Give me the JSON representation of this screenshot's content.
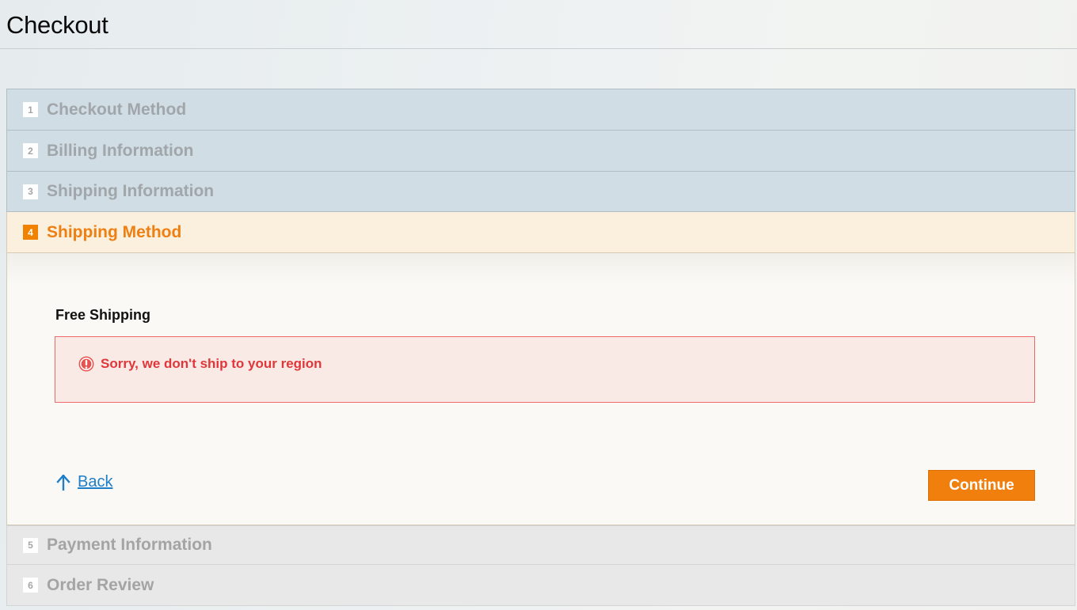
{
  "page": {
    "title": "Checkout"
  },
  "steps": [
    {
      "number": "1",
      "label": "Checkout Method",
      "state": "complete"
    },
    {
      "number": "2",
      "label": "Billing Information",
      "state": "complete"
    },
    {
      "number": "3",
      "label": "Shipping Information",
      "state": "complete"
    },
    {
      "number": "4",
      "label": "Shipping Method",
      "state": "active"
    },
    {
      "number": "5",
      "label": "Payment Information",
      "state": "pending"
    },
    {
      "number": "6",
      "label": "Order Review",
      "state": "pending"
    }
  ],
  "shipping_method": {
    "method_title": "Free Shipping",
    "error_message": "Sorry, we don't ship to your region",
    "back_label": "Back",
    "continue_label": "Continue"
  },
  "colors": {
    "accent": "#f07f0d",
    "error": "#e0373a",
    "link": "#1e7ec8"
  },
  "icons": {
    "error": "error-circle-icon",
    "back": "arrow-up-icon"
  }
}
